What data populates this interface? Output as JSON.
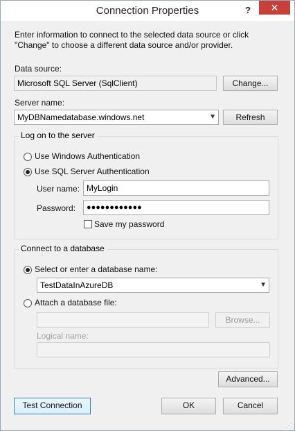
{
  "window": {
    "title": "Connection Properties",
    "help_label": "?",
    "close_label": "✕"
  },
  "intro_text": "Enter information to connect to the selected data source or click \"Change\" to choose a different data source and/or provider.",
  "data_source": {
    "label": "Data source:",
    "value": "Microsoft SQL Server (SqlClient)",
    "change_button": "Change..."
  },
  "server": {
    "label": "Server name:",
    "value": "MyDBNamedatabase.windows.net",
    "refresh_button": "Refresh"
  },
  "logon": {
    "group_title": "Log on to the server",
    "windows_auth": "Use Windows Authentication",
    "sql_auth": "Use SQL Server Authentication",
    "selected": "sql_auth",
    "user_label": "User name:",
    "user_value": "MyLogin",
    "password_label": "Password:",
    "password_value": "●●●●●●●●●●●●",
    "save_password": "Save my password",
    "save_password_checked": false
  },
  "database": {
    "group_title": "Connect to a database",
    "select_option": "Select or enter a database name:",
    "db_value": "TestDataInAzureDB",
    "attach_option": "Attach a database file:",
    "browse_button": "Browse...",
    "logical_name_label": "Logical name:"
  },
  "buttons": {
    "advanced": "Advanced...",
    "test_connection": "Test Connection",
    "ok": "OK",
    "cancel": "Cancel"
  }
}
